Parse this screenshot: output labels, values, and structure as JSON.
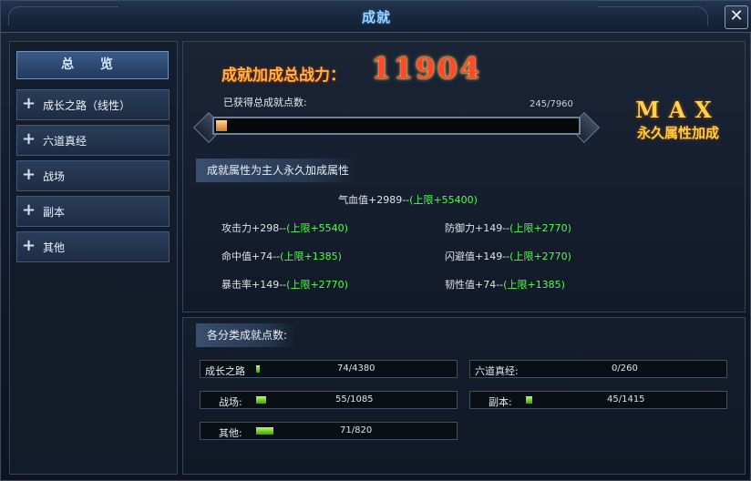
{
  "window": {
    "title": "成就",
    "close_glyph": "✕"
  },
  "sidebar": {
    "overview_label": "总 览",
    "items": [
      {
        "label": "成长之路（线性）"
      },
      {
        "label": "六道真经"
      },
      {
        "label": "战场"
      },
      {
        "label": "副本"
      },
      {
        "label": "其他"
      }
    ]
  },
  "summary": {
    "power_label": "成就加成总战力：",
    "power_value": "11904",
    "points_label": "已获得总成就点数:",
    "points_value": "245/7960",
    "progress_fraction": 0.0308,
    "max_title": "MAX",
    "max_subtitle": "永久属性加成"
  },
  "attributes": {
    "section_title": "成就属性为主人永久加成属性",
    "hp": {
      "text": "气血值+2989--",
      "limit": "(上限+55400)"
    },
    "attack": {
      "text": "攻击力+298--",
      "limit": "(上限+5540)"
    },
    "defense": {
      "text": "防御力+149--",
      "limit": "(上限+2770)"
    },
    "hit": {
      "text": "命中值+74--",
      "limit": "(上限+1385)"
    },
    "dodge": {
      "text": "闪避值+149--",
      "limit": "(上限+2770)"
    },
    "crit": {
      "text": "暴击率+149--",
      "limit": "(上限+2770)"
    },
    "toughness": {
      "text": "韧性值+74--",
      "limit": "(上限+1385)"
    }
  },
  "categories": {
    "section_title": "各分类成就点数:",
    "items": [
      {
        "name": "成长之路",
        "value": "74/4380",
        "fraction": 0.017
      },
      {
        "name": "六道真经:",
        "value": "0/260",
        "fraction": 0
      },
      {
        "name": "战场:",
        "value": "55/1085",
        "fraction": 0.05
      },
      {
        "name": "副本:",
        "value": "45/1415",
        "fraction": 0.032
      },
      {
        "name": "其他:",
        "value": "71/820",
        "fraction": 0.087
      }
    ]
  },
  "colors": {
    "accent_orange": "#ffb24a",
    "power_red": "#ff4a2a",
    "limit_green": "#4cff46",
    "max_gold": "#ffd24a"
  }
}
